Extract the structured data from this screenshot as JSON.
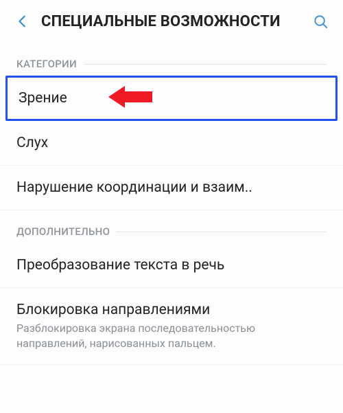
{
  "header": {
    "title": "СПЕЦИАЛЬНЫЕ ВОЗМОЖНОСТИ"
  },
  "sections": {
    "categories": {
      "label": "КАТЕГОРИИ",
      "items": [
        {
          "title": "Зрение"
        },
        {
          "title": "Слух"
        },
        {
          "title": "Нарушение координации и взаим.."
        }
      ]
    },
    "extra": {
      "label": "ДОПОЛНИТЕЛЬНО",
      "items": [
        {
          "title": "Преобразование текста в речь"
        },
        {
          "title": "Блокировка направлениями",
          "sub": "Разблокировка экрана последовательностью направлений, нарисованных пальцем."
        }
      ]
    }
  }
}
